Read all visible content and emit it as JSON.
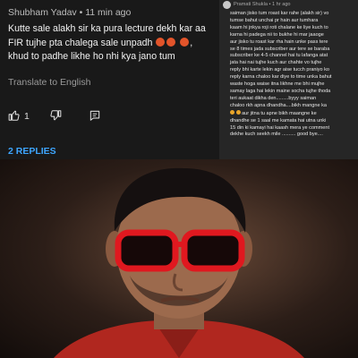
{
  "main_comment": {
    "author": "Shubham Yadav",
    "time": "11 min ago",
    "text": "Kutte sale alakh sir ka pura lecture dekh kar aa FIR tujhe pta chalega sale unpadh",
    "text_after_emoji": ", khud to padhe likhe ho nhi kya jano tum",
    "emoji": [
      "angry-face",
      "angry-face",
      "angry-face"
    ],
    "translate_label": "Translate to English",
    "like_count": "1",
    "replies_label": "2 REPLIES"
  },
  "side_comment": {
    "author": "Pramati Shukla",
    "time": "1 hr ago",
    "lines": [
      "saiman jisko tum roast kar rahe (alakh sir) vo",
      "tumse bahut unchai pr hain aur tumhara",
      "kaam hi jnkya roji roti chalane ke liye kuch to",
      "karna hi padega nii to bukhe hi mar jaaoge",
      "aur jisko tu roast kar rha hain unke pass tere",
      "se 8 times jada subscriber aur tere se baraba",
      "subscriber ke 4-5 channel hai tu lafanga atat",
      "jata hai nai tujhe kuch aur chahte vo tujhe",
      "reply bhi karte lekin agr aise tucch praniyo ko",
      "reply karna chaloo kar diye to time unka bahut",
      "waste hoga waise itna likhne me bhi mujhe",
      "samay laga hai lekin maine socha tujhe thoda",
      "teri aukaat dikha den.........byyy saiman",
      "chaloo rkh apna dhandha....bikh mangne ka"
    ],
    "emoji_line_text": "aur jitna tu apne bikh maangne ke",
    "lines_after": [
      "dhandhe se 1 saal me kamata hai utna unki",
      "15 din ki kamayi hai kaash mera ye comment",
      "dekhe kuch seekh mile .......... good bye...."
    ]
  },
  "photo": {
    "subject": "man-with-red-sunglasses"
  }
}
